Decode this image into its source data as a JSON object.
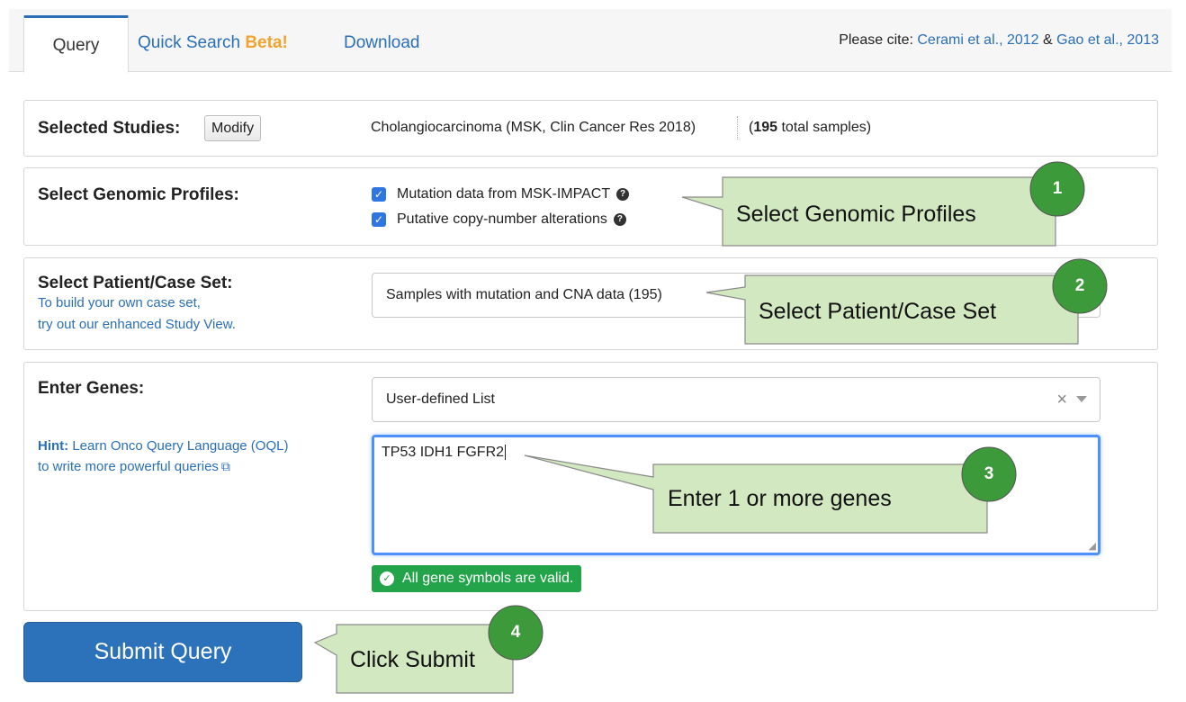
{
  "tabs": {
    "query": "Query",
    "quick_search": "Quick Search",
    "quick_search_badge": "Beta!",
    "download": "Download"
  },
  "cite": {
    "prefix": "Please cite:",
    "ref1": "Cerami et al., 2012",
    "amp": "&",
    "ref2": "Gao et al., 2013"
  },
  "studies": {
    "label": "Selected Studies:",
    "modify": "Modify",
    "study_name": "Cholangiocarcinoma (MSK, Clin Cancer Res 2018)",
    "count_open": "(",
    "count": "195",
    "count_suffix": " total samples)"
  },
  "profiles": {
    "label": "Select Genomic Profiles:",
    "items": [
      {
        "label": "Mutation data from MSK-IMPACT",
        "checked": true
      },
      {
        "label": "Putative copy-number alterations",
        "checked": true
      }
    ]
  },
  "caseset": {
    "label": "Select Patient/Case Set:",
    "note_line1": "To build your own case set,",
    "note_line2": "try out our enhanced Study View.",
    "selected": "Samples with mutation and CNA data (195)"
  },
  "genes": {
    "label": "Enter Genes:",
    "hint_prefix": "Hint:",
    "hint_line1": "Learn Onco Query Language (OQL)",
    "hint_line2": "to write more powerful queries",
    "list_select": "User-defined List",
    "input_value": "TP53 IDH1 FGFR2",
    "valid_message": "All gene symbols are valid."
  },
  "submit_label": "Submit Query",
  "callouts": [
    {
      "number": "1",
      "text": "Select Genomic Profiles"
    },
    {
      "number": "2",
      "text": "Select Patient/Case Set"
    },
    {
      "number": "3",
      "text": "Enter 1 or more genes"
    },
    {
      "number": "4",
      "text": "Click Submit"
    }
  ],
  "colors": {
    "link": "#2a6fb8",
    "beta": "#f0a32f",
    "submit": "#2c72ba",
    "valid": "#23a34a",
    "callout_fill": "#d2e8c0",
    "callout_number": "#3c9a3a"
  }
}
